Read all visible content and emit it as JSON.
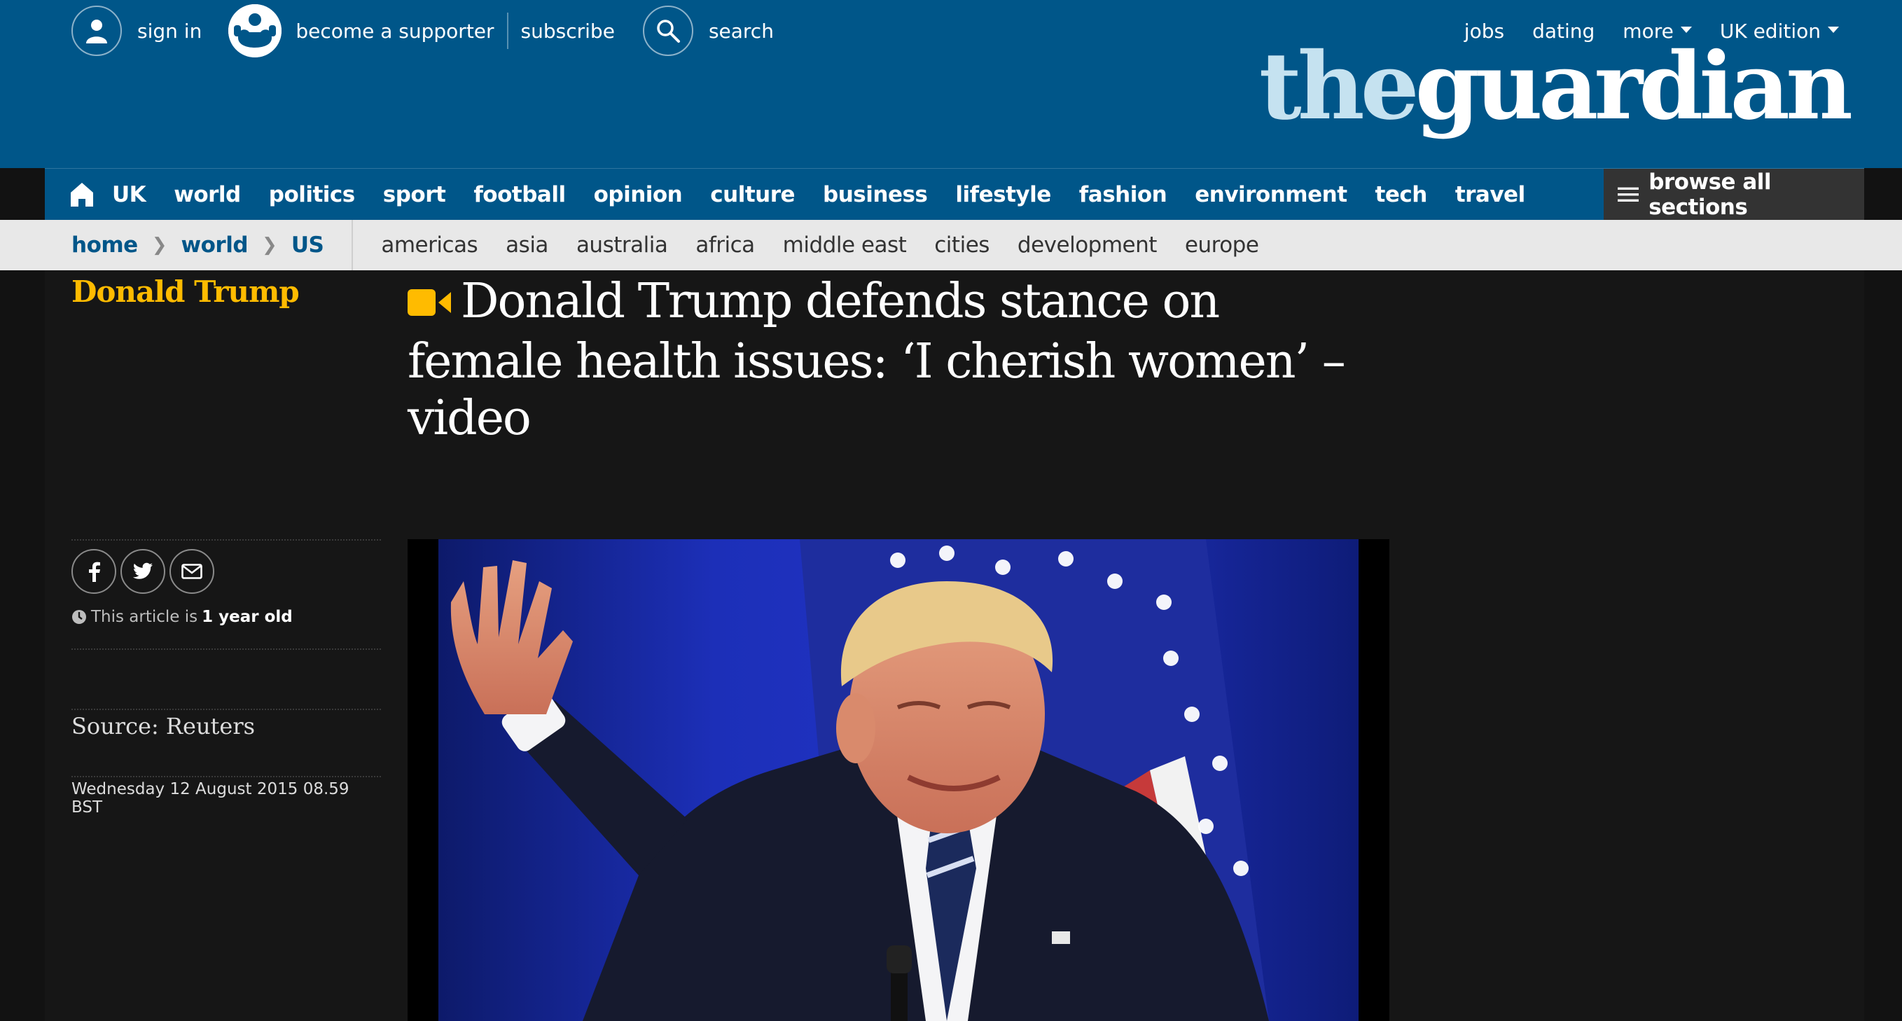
{
  "header": {
    "sign_in": "sign in",
    "become_supporter": "become a supporter",
    "subscribe": "subscribe",
    "search": "search",
    "jobs": "jobs",
    "dating": "dating",
    "more": "more",
    "edition": "UK edition",
    "logo_the": "the",
    "logo_guardian": "guardian"
  },
  "nav": {
    "items": [
      "UK",
      "world",
      "politics",
      "sport",
      "football",
      "opinion",
      "culture",
      "business",
      "lifestyle",
      "fashion",
      "environment",
      "tech",
      "travel"
    ],
    "browse_all": "browse all sections"
  },
  "subnav": {
    "breadcrumbs": [
      "home",
      "world",
      "US"
    ],
    "items": [
      "americas",
      "asia",
      "australia",
      "africa",
      "middle east",
      "cities",
      "development",
      "europe"
    ]
  },
  "article": {
    "section": "Donald Trump",
    "headline": "Donald Trump defends stance on female health issues: ‘I cherish women’ – video",
    "age_prefix": "This article is",
    "age_value": "1 year old",
    "source": "Source: Reuters",
    "date": "Wednesday 12 August 2015 08.59 BST"
  },
  "colors": {
    "brand_blue": "#005689",
    "section_yellow": "#ffbb00",
    "logo_light": "#c5e2f0"
  },
  "icons": [
    "user-icon",
    "supporter-icon",
    "search-icon",
    "home-icon",
    "hamburger-icon",
    "video-icon",
    "facebook-icon",
    "twitter-icon",
    "email-icon",
    "clock-icon"
  ]
}
